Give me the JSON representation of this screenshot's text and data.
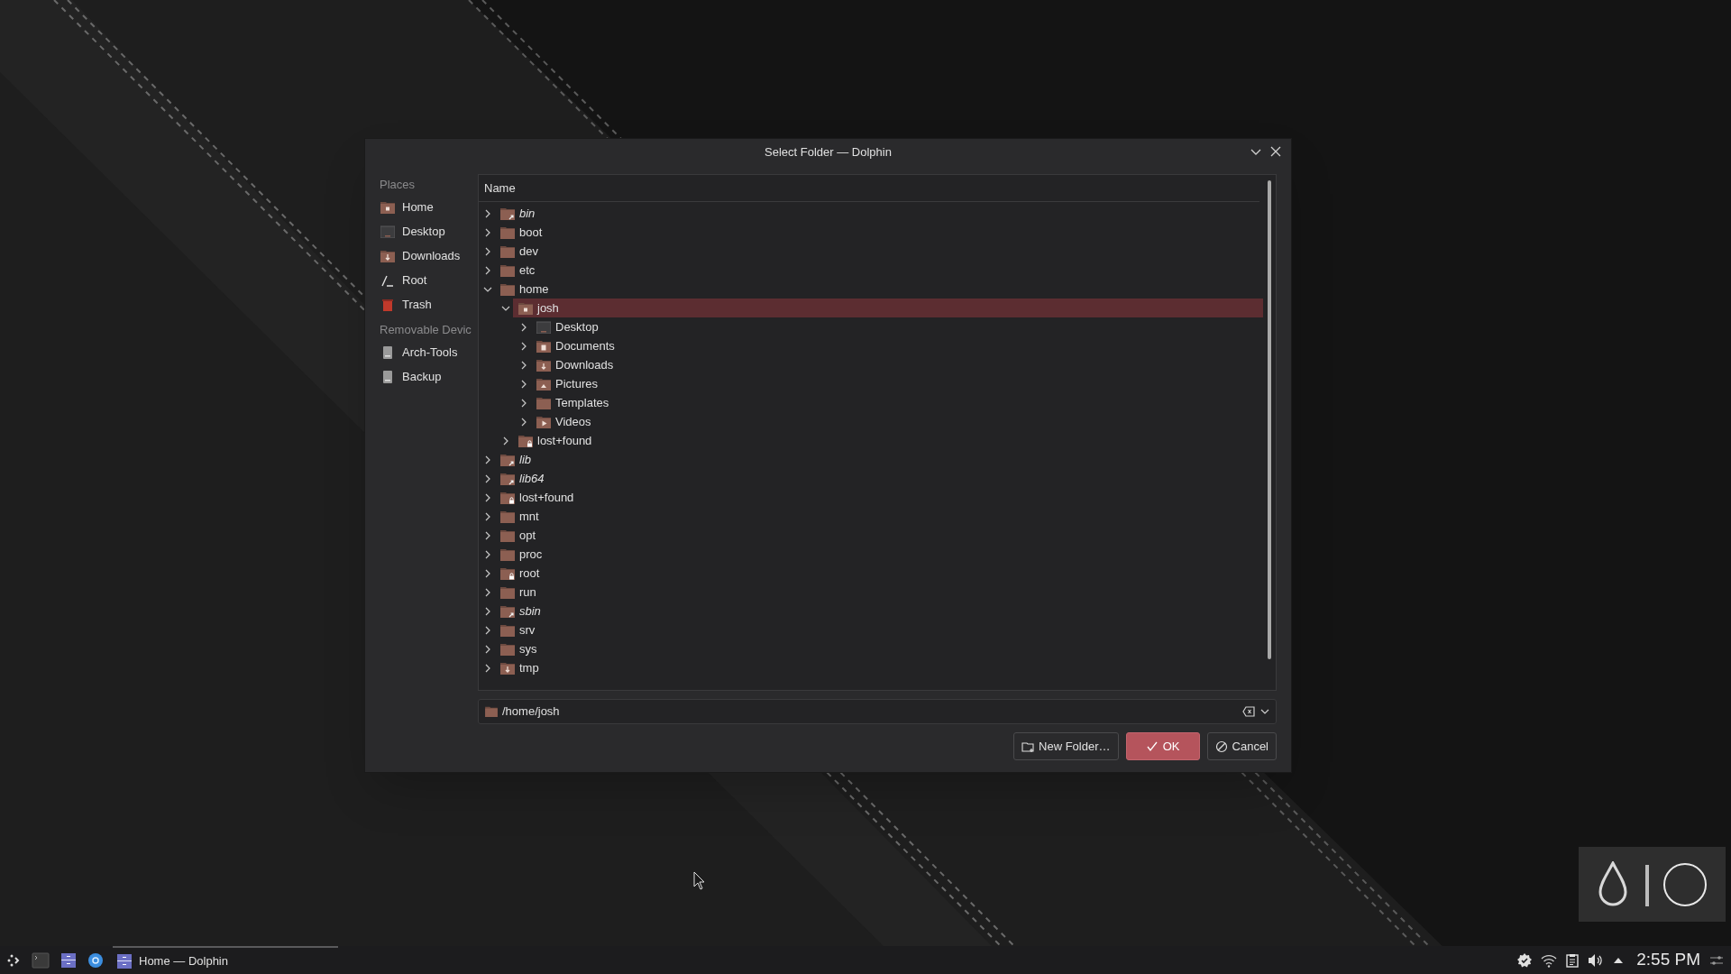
{
  "window": {
    "title": "Select Folder — Dolphin"
  },
  "places": {
    "heading": "Places",
    "items": [
      {
        "label": "Home",
        "kind": "home"
      },
      {
        "label": "Desktop",
        "kind": "desktop"
      },
      {
        "label": "Downloads",
        "kind": "downloads"
      },
      {
        "label": "Root",
        "kind": "root"
      },
      {
        "label": "Trash",
        "kind": "trash"
      }
    ]
  },
  "removable": {
    "heading": "Removable Devic",
    "items": [
      {
        "label": "Arch-Tools",
        "kind": "drive"
      },
      {
        "label": "Backup",
        "kind": "drive"
      }
    ]
  },
  "tree": {
    "column": "Name",
    "items": [
      {
        "label": "bin",
        "kind": "symlink",
        "expanded": false,
        "selected": false
      },
      {
        "label": "boot",
        "kind": "folder",
        "expanded": false,
        "selected": false
      },
      {
        "label": "dev",
        "kind": "folder",
        "expanded": false,
        "selected": false
      },
      {
        "label": "etc",
        "kind": "folder",
        "expanded": false,
        "selected": false
      },
      {
        "label": "home",
        "kind": "folder",
        "expanded": true,
        "selected": false,
        "children": [
          {
            "label": "josh",
            "kind": "home",
            "expanded": true,
            "selected": true,
            "children": [
              {
                "label": "Desktop",
                "kind": "desktop",
                "expanded": false,
                "selected": false
              },
              {
                "label": "Documents",
                "kind": "documents",
                "expanded": false,
                "selected": false
              },
              {
                "label": "Downloads",
                "kind": "downloads",
                "expanded": false,
                "selected": false
              },
              {
                "label": "Pictures",
                "kind": "pictures",
                "expanded": false,
                "selected": false
              },
              {
                "label": "Templates",
                "kind": "folder",
                "expanded": false,
                "selected": false
              },
              {
                "label": "Videos",
                "kind": "videos",
                "expanded": false,
                "selected": false
              }
            ]
          },
          {
            "label": "lost+found",
            "kind": "locked",
            "expanded": false,
            "selected": false
          }
        ]
      },
      {
        "label": "lib",
        "kind": "symlink",
        "expanded": false,
        "selected": false
      },
      {
        "label": "lib64",
        "kind": "symlink",
        "expanded": false,
        "selected": false
      },
      {
        "label": "lost+found",
        "kind": "locked",
        "expanded": false,
        "selected": false
      },
      {
        "label": "mnt",
        "kind": "folder",
        "expanded": false,
        "selected": false
      },
      {
        "label": "opt",
        "kind": "folder",
        "expanded": false,
        "selected": false
      },
      {
        "label": "proc",
        "kind": "folder",
        "expanded": false,
        "selected": false
      },
      {
        "label": "root",
        "kind": "locked",
        "expanded": false,
        "selected": false
      },
      {
        "label": "run",
        "kind": "folder",
        "expanded": false,
        "selected": false
      },
      {
        "label": "sbin",
        "kind": "symlink",
        "expanded": false,
        "selected": false
      },
      {
        "label": "srv",
        "kind": "folder",
        "expanded": false,
        "selected": false
      },
      {
        "label": "sys",
        "kind": "folder",
        "expanded": false,
        "selected": false
      },
      {
        "label": "tmp",
        "kind": "downloads",
        "expanded": false,
        "selected": false
      }
    ]
  },
  "location": {
    "value": "/home/josh"
  },
  "buttons": [
    {
      "label": "New Folder…",
      "kind": "new-folder"
    },
    {
      "label": "OK",
      "kind": "ok"
    },
    {
      "label": "Cancel",
      "kind": "cancel"
    }
  ],
  "taskbar": {
    "tasks": [
      {
        "label": "Home — Dolphin",
        "selected": true
      }
    ],
    "clock": "2:55 PM"
  }
}
